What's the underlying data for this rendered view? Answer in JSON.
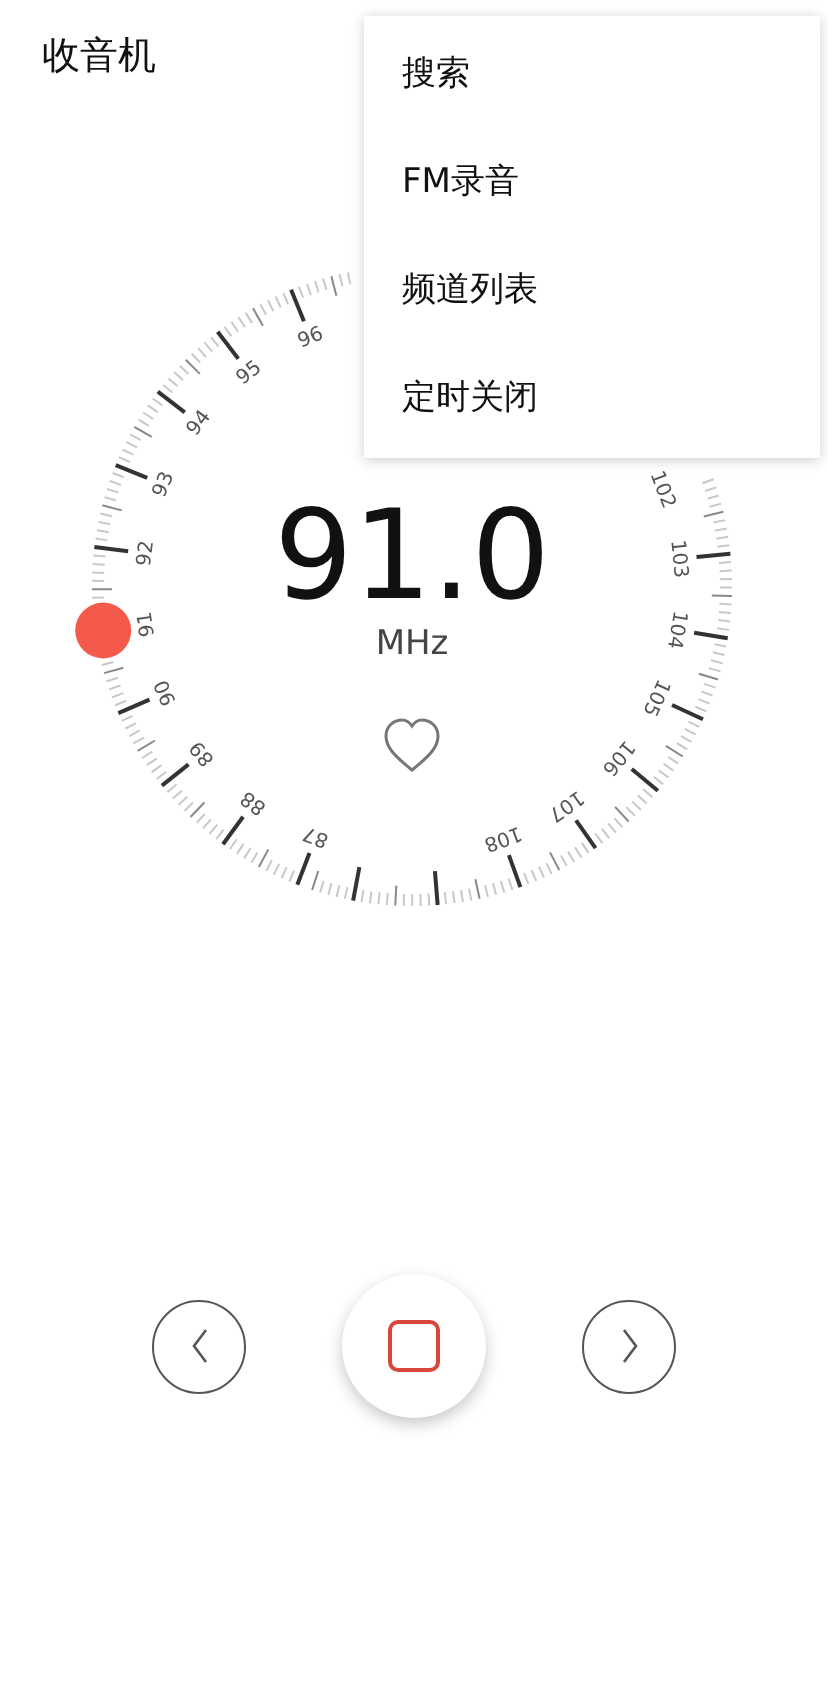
{
  "title": "收音机",
  "dial": {
    "frequency": "91.0",
    "unit": "MHz",
    "favorite": false,
    "labels": [
      {
        "text": "87"
      },
      {
        "text": "88"
      },
      {
        "text": "89"
      },
      {
        "text": "90"
      },
      {
        "text": "91"
      },
      {
        "text": "92"
      },
      {
        "text": "93"
      },
      {
        "text": "94"
      },
      {
        "text": "95"
      },
      {
        "text": "96"
      },
      {
        "text": "102"
      },
      {
        "text": "103"
      },
      {
        "text": "104"
      },
      {
        "text": "105"
      },
      {
        "text": "106"
      },
      {
        "text": "107"
      },
      {
        "text": "108"
      }
    ]
  },
  "controls": {
    "playing": true
  },
  "menu": {
    "items": [
      {
        "label": "搜索"
      },
      {
        "label": "FM录音"
      },
      {
        "label": "频道列表"
      },
      {
        "label": "定时关闭"
      }
    ]
  }
}
